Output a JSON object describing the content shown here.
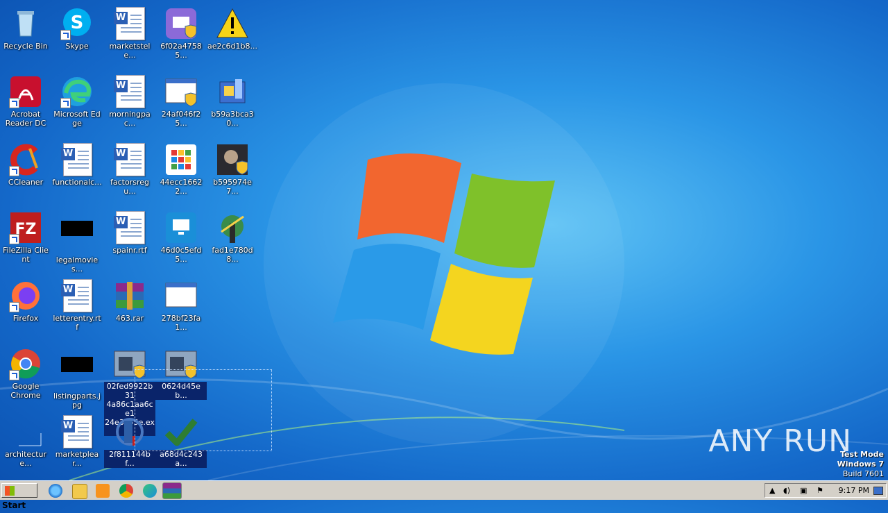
{
  "desktop": {
    "icons": [
      {
        "label": "Recycle Bin"
      },
      {
        "label": "Skype"
      },
      {
        "label": "marketstele..."
      },
      {
        "label": "6f02a47585..."
      },
      {
        "label": "ae2c6d1b8..."
      },
      {
        "label": "Acrobat\nReader DC"
      },
      {
        "label": "Microsoft Edge"
      },
      {
        "label": "morningpac..."
      },
      {
        "label": "24af046f25..."
      },
      {
        "label": "b59a3bca30..."
      },
      {
        "label": "CCleaner"
      },
      {
        "label": "functionalc..."
      },
      {
        "label": "factorsregu..."
      },
      {
        "label": "44ecc16622..."
      },
      {
        "label": "b595974e7..."
      },
      {
        "label": "FileZilla Client"
      },
      {
        "label": "legalmovies..."
      },
      {
        "label": "spainr.rtf"
      },
      {
        "label": "46d0c5efd5..."
      },
      {
        "label": "fad1e780d8..."
      },
      {
        "label": "Firefox"
      },
      {
        "label": "letterentry.rtf"
      },
      {
        "label": "463.rar"
      },
      {
        "label": "278bf23fa1..."
      },
      {
        "label": "Google\nChrome"
      },
      {
        "label": "listingparts.jpg"
      },
      {
        "label": "02fed9922b31\n4a86c1aa6ce1\n24e3a55e.exe"
      },
      {
        "label": "0624d45eb..."
      },
      {
        "label": "architecture..."
      },
      {
        "label": "marketplear..."
      },
      {
        "label": "2f811144bf..."
      },
      {
        "label": "a68d4c243a..."
      }
    ]
  },
  "watermark": "ANY RUN",
  "test_mode": {
    "line1": "Test Mode",
    "line2": "Windows 7",
    "line3": "Build 7601"
  },
  "taskbar": {
    "start_label": "Start",
    "clock": "9:17 PM",
    "pinned": [
      "ie-icon",
      "explorer-icon",
      "media-player-icon",
      "chrome-icon",
      "edge-icon",
      "winrar-icon"
    ]
  },
  "colors": {
    "accent": "#1468c9",
    "taskbar": "#d4d0c8",
    "selection": "#0a246a"
  }
}
